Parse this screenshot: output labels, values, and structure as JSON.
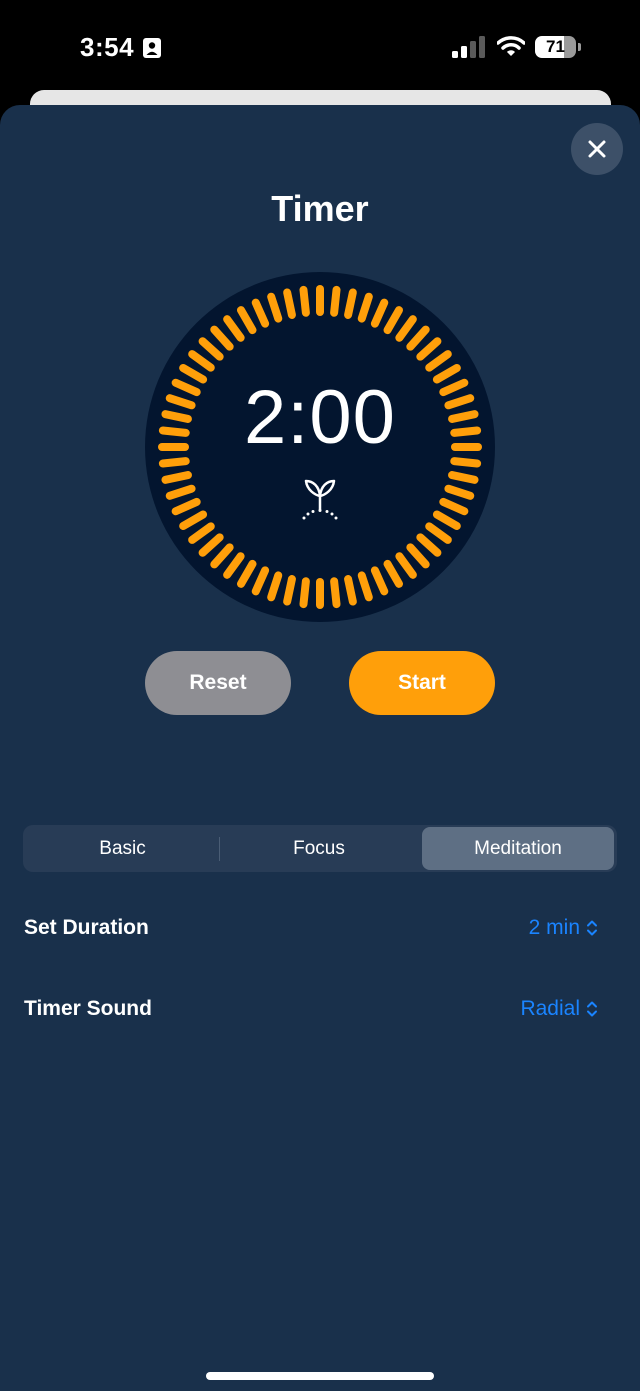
{
  "status_bar": {
    "time": "3:54",
    "battery": "71",
    "battery_level": 0.71,
    "icons": [
      "person-icon",
      "signal-icon",
      "wifi-icon",
      "battery-icon"
    ]
  },
  "sheet": {
    "title": "Timer",
    "close_icon": "close-icon"
  },
  "timer": {
    "display": "2:00",
    "icon": "sprout-icon",
    "tick_count": 60,
    "tick_color": "#ff9f0a",
    "dial_color": "#03152f"
  },
  "buttons": {
    "reset": "Reset",
    "start": "Start"
  },
  "modes": {
    "items": [
      "Basic",
      "Focus",
      "Meditation"
    ],
    "selected": "Meditation"
  },
  "settings": {
    "duration_label": "Set Duration",
    "duration_value": "2 min",
    "sound_label": "Timer Sound",
    "sound_value": "Radial"
  },
  "colors": {
    "sheet_bg": "#19304b",
    "accent": "#ff9f0a",
    "link": "#1a84ff"
  }
}
